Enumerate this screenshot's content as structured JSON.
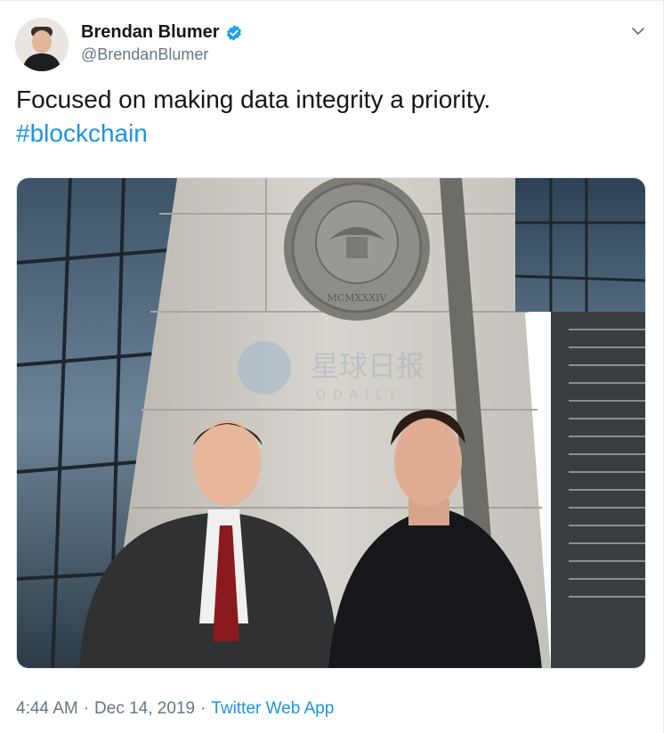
{
  "tweet": {
    "author": {
      "name": "Brendan Blumer",
      "handle": "@BrendanBlumer",
      "verified": true
    },
    "text": "Focused on making data integrity a priority.",
    "hashtag": "#blockchain",
    "photo": {
      "watermark_cn": "星球日报",
      "watermark_en": "ODAILY",
      "seal_text": "MCMXXXIV"
    },
    "time": "4:44 AM",
    "separator": "·",
    "date": "Dec 14, 2019",
    "source": "Twitter Web App"
  },
  "colors": {
    "link": "#1b95e0",
    "verified": "#1da1f2",
    "muted": "#657786",
    "text": "#14171a"
  },
  "icons": {
    "menu": "chevron-down-icon",
    "verified": "verified-badge-icon"
  }
}
